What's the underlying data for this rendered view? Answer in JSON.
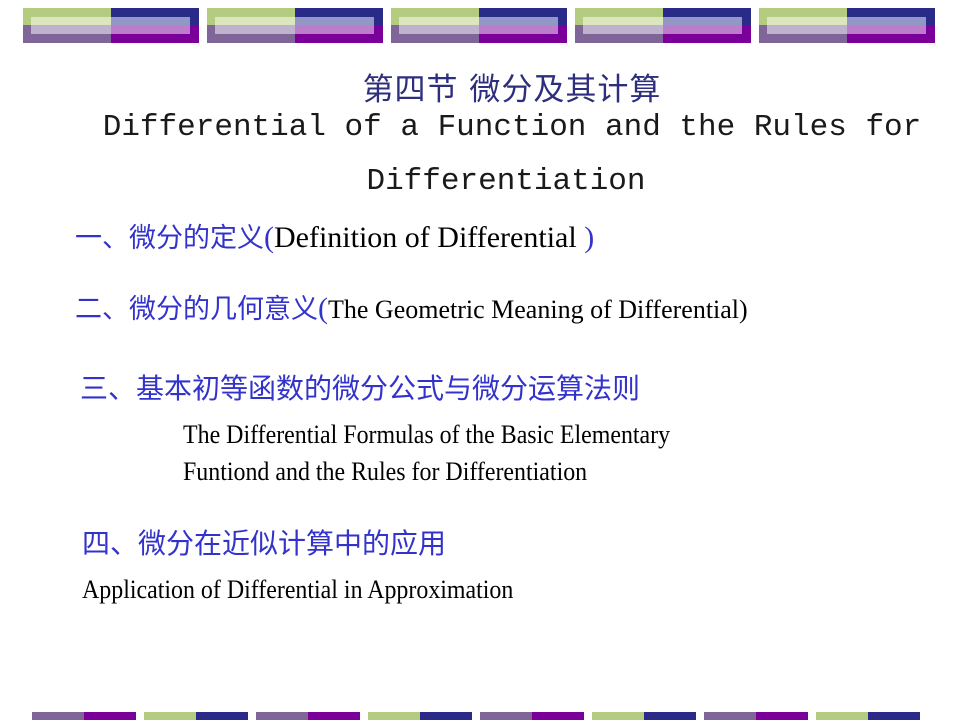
{
  "colors": {
    "green": "#b4cc80",
    "navy": "#2a2a88",
    "purple_gray": "#7f6598",
    "purple": "#7a0099",
    "title": "#2e2e7e",
    "heading_cn": "#3333cc",
    "body": "#000000"
  },
  "header": {
    "title_cn": "第四节 微分及其计算",
    "title_en_line1": "Differential of a Function and the Rules for",
    "title_en_line2": "Differentiation"
  },
  "sections": [
    {
      "number_cn": "一、",
      "title_cn": "微分的定义",
      "open_paren": "(",
      "title_en": "Definition of Differential ",
      "close_paren": ")"
    },
    {
      "number_cn": "二、",
      "title_cn": "微分的几何意义",
      "open_paren": "(",
      "title_en": "The Geometric Meaning of Differential)"
    },
    {
      "number_cn": "三、",
      "title_cn": "基本初等函数的微分公式与微分运算法则",
      "title_en_line1": "The Differential Formulas of the Basic Elementary",
      "title_en_line2": "Funtiond and the Rules for Differentiation"
    },
    {
      "number_cn": "四、",
      "title_cn": "微分在近似计算中的应用",
      "title_en": "Application of Differential in Approximation"
    }
  ]
}
